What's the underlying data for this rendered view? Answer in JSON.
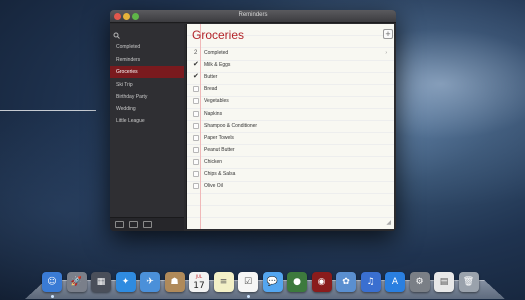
{
  "window": {
    "title": "Reminders"
  },
  "sidebar": {
    "search_icon": "search-icon",
    "items": [
      {
        "label": "Completed"
      },
      {
        "label": "Reminders"
      },
      {
        "label": "Groceries",
        "selected": true
      },
      {
        "label": "Ski Trip"
      },
      {
        "label": "Birthday Party"
      },
      {
        "label": "Wedding"
      },
      {
        "label": "Little League"
      }
    ],
    "bottom_icons": [
      "calendar-toggle-icon",
      "view-toggle-icon",
      "add-list-icon"
    ]
  },
  "list": {
    "title": "Groceries",
    "add_button": "+",
    "completed": {
      "count": "2",
      "label": "Completed",
      "chevron": "›"
    },
    "items": [
      {
        "label": "Milk & Eggs",
        "checked": true
      },
      {
        "label": "Butter",
        "checked": true
      },
      {
        "label": "Bread",
        "checked": false
      },
      {
        "label": "Vegetables",
        "checked": false
      },
      {
        "label": "Napkins",
        "checked": false
      },
      {
        "label": "Shampoo & Conditioner",
        "checked": false
      },
      {
        "label": "Paper Towels",
        "checked": false
      },
      {
        "label": "Peanut Butter",
        "checked": false
      },
      {
        "label": "Chicken",
        "checked": false
      },
      {
        "label": "Chips & Salsa",
        "checked": false
      },
      {
        "label": "Olive Oil",
        "checked": false
      }
    ]
  },
  "calendar_icon_text": {
    "month": "JUL",
    "day": "17"
  },
  "dock": {
    "icons": [
      {
        "name": "finder-icon",
        "glyph": "☺",
        "color": "#3a7bd5"
      },
      {
        "name": "launchpad-icon",
        "glyph": "🚀",
        "color": "#7a7f8a"
      },
      {
        "name": "mission-control-icon",
        "glyph": "▦",
        "color": "#4a4f5a"
      },
      {
        "name": "safari-icon",
        "glyph": "✦",
        "color": "#2f8be0"
      },
      {
        "name": "mail-icon",
        "glyph": "✈",
        "color": "#4b90d9"
      },
      {
        "name": "contacts-icon",
        "glyph": "☗",
        "color": "#b08a5a"
      },
      {
        "name": "calendar-icon",
        "glyph": "",
        "color": "#f2f2f2"
      },
      {
        "name": "notes-icon",
        "glyph": "≡",
        "color": "#f3f0c7"
      },
      {
        "name": "reminders-icon",
        "glyph": "☑",
        "color": "#f6f6f6"
      },
      {
        "name": "messages-icon",
        "glyph": "💬",
        "color": "#54a6f0"
      },
      {
        "name": "facetime-icon",
        "glyph": "●",
        "color": "#3d7a3d"
      },
      {
        "name": "photo-booth-icon",
        "glyph": "◉",
        "color": "#8a1c1c"
      },
      {
        "name": "iphoto-icon",
        "glyph": "✿",
        "color": "#5a8fd0"
      },
      {
        "name": "itunes-icon",
        "glyph": "♫",
        "color": "#3a6fd0"
      },
      {
        "name": "app-store-icon",
        "glyph": "A",
        "color": "#2a7fe0"
      },
      {
        "name": "system-preferences-icon",
        "glyph": "⚙",
        "color": "#7a7f86"
      },
      {
        "name": "documents-stack-icon",
        "glyph": "▤",
        "color": "#e8e8e8"
      },
      {
        "name": "trash-icon",
        "glyph": "🗑",
        "color": "#9aa2ac"
      }
    ]
  }
}
